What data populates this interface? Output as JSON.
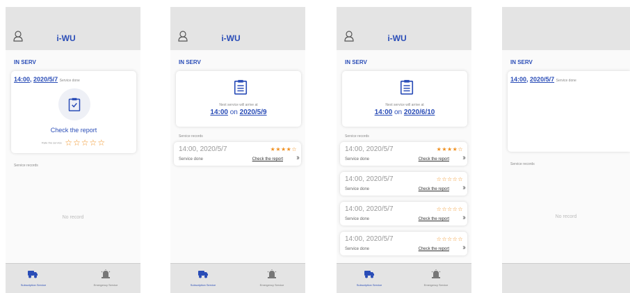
{
  "app": {
    "title": "i-WU"
  },
  "section_title": "IN SERV",
  "service_records_label": "Service records",
  "no_record": "No record",
  "done_card": {
    "time": "14:00",
    "date": "2020/5/7",
    "status": "Service done",
    "check_report": "Check the report",
    "rate_label": "Rate the service",
    "stars": "☆☆☆☆☆"
  },
  "next_card_2": {
    "line1": "Next service will arrive at",
    "time": "14:00",
    "on": "on",
    "date": "2020/5/9"
  },
  "next_card_3": {
    "line1": "Next service will arrive at",
    "time": "14:00",
    "on": "on",
    "date": "2020/6/10"
  },
  "records_2": [
    {
      "datetime": "14:00, 2020/5/7",
      "status": "Service done",
      "link": "Check the report",
      "stars": "★★★★☆",
      "rating": 4
    }
  ],
  "records_3": [
    {
      "datetime": "14:00, 2020/5/7",
      "status": "Service done",
      "link": "Check the report",
      "stars": "★★★★☆",
      "rating": 4
    },
    {
      "datetime": "14:00, 2020/5/7",
      "status": "Service done",
      "link": "Check the report",
      "stars": "☆☆☆☆☆",
      "rating": 0
    },
    {
      "datetime": "14:00, 2020/5/7",
      "status": "Service done",
      "link": "Check the report",
      "stars": "☆☆☆☆☆",
      "rating": 0
    },
    {
      "datetime": "14:00, 2020/5/7",
      "status": "Service done",
      "link": "Check the report",
      "stars": "☆☆☆☆☆",
      "rating": 0
    }
  ],
  "chevrons": "›››",
  "footer": {
    "subscription": "Subscription Service",
    "emergency": "Emergency Service"
  },
  "colors": {
    "accent": "#2a4db7",
    "star": "#f09020",
    "header": "#e4e4e4"
  },
  "icons": [
    "user-icon",
    "clipboard-icon",
    "clipboard-check-icon",
    "truck-icon",
    "siren-icon"
  ]
}
